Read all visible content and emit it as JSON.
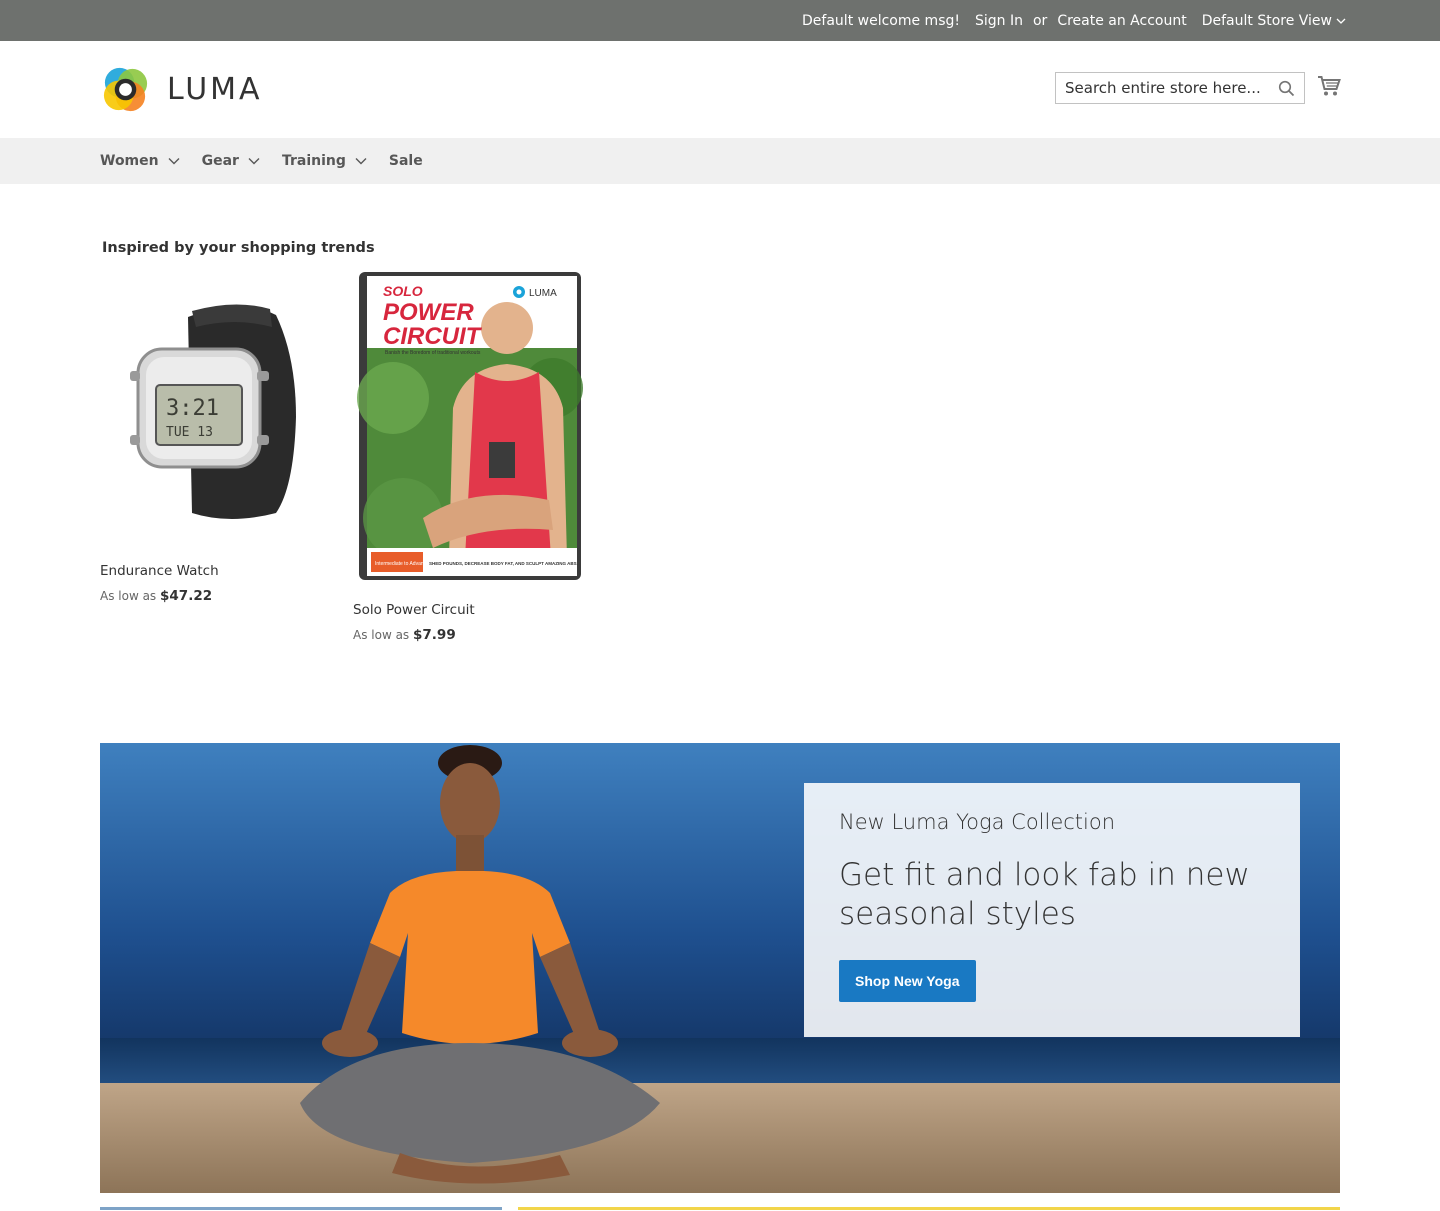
{
  "top_panel": {
    "welcome": "Default welcome msg!",
    "sign_in": "Sign In",
    "or": "or",
    "create_account": "Create an Account",
    "store_view": "Default Store View"
  },
  "header": {
    "logo_text": "LUMA",
    "search_placeholder": "Search entire store here...",
    "icons": [
      "search-icon",
      "cart-icon",
      "chevron-down-icon"
    ]
  },
  "nav": {
    "items": [
      {
        "label": "Women",
        "has_dropdown": true
      },
      {
        "label": "Gear",
        "has_dropdown": true
      },
      {
        "label": "Training",
        "has_dropdown": true
      },
      {
        "label": "Sale",
        "has_dropdown": false
      }
    ]
  },
  "recommendations": {
    "title": "Inspired by your shopping trends",
    "products": [
      {
        "name": "Endurance Watch",
        "price_prefix": "As low as",
        "price": "$47.22"
      },
      {
        "name": "Solo Power Circuit",
        "price_prefix": "As low as",
        "price": "$7.99"
      }
    ]
  },
  "dvd_cover": {
    "title_line1": "SOLO",
    "title_line2": "POWER",
    "title_line3": "CIRCUIT",
    "brand": "LUMA",
    "tagline": "Banish the Boredom of traditional workouts",
    "level": "Intermediate to Advanced",
    "blurb": "SHED POUNDS, DECREASE BODY FAT, AND SCULPT AMAZING ABS."
  },
  "watch_display": {
    "time": "3:21",
    "day": "TUE 13"
  },
  "banner": {
    "eyebrow": "New Luma Yoga Collection",
    "headline": "Get fit and look fab in new seasonal styles",
    "cta": "Shop New Yoga"
  },
  "colors": {
    "top_panel_bg": "#6e716e",
    "nav_bg": "#f0f0f0",
    "button_blue": "#1979c3"
  }
}
